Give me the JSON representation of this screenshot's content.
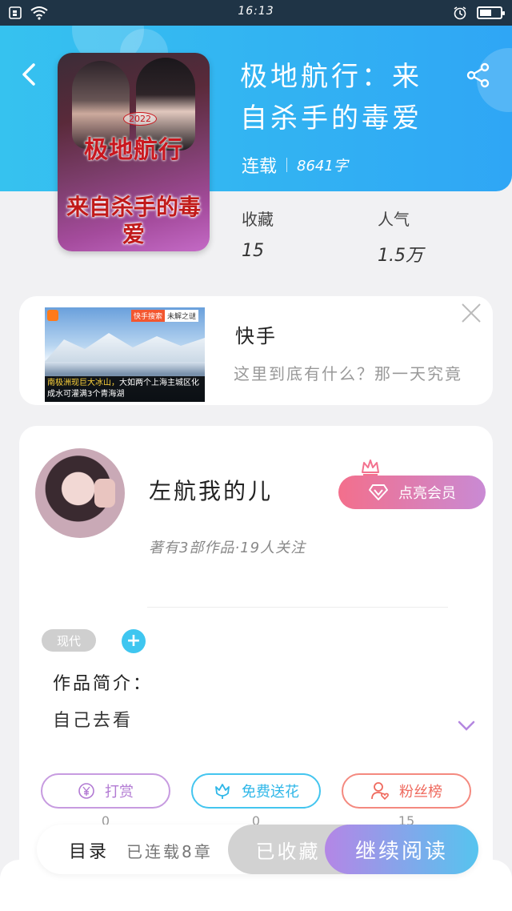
{
  "status_bar": {
    "time": "16:13"
  },
  "book": {
    "cover_title_line1": "极地航行",
    "cover_year": "2022",
    "cover_title_line2": "来自杀手的毒爱",
    "title_line1": "极地航行：来",
    "title_line2": "自杀手的毒爱",
    "status": "连载",
    "word_count": "8641字"
  },
  "stats": {
    "favorites_label": "收藏",
    "favorites_value": "15",
    "popularity_label": "人气",
    "popularity_value": "1.5万"
  },
  "ad": {
    "title": "快手",
    "description": "这里到底有什么？那一天究竟",
    "image_tag_search": "快手搜索",
    "image_tag_mystery": "未解之谜",
    "image_caption_highlight": "南极洲现巨大冰山，",
    "image_caption_rest": "大如两个上海主城区化成水可灌满3个青海湖"
  },
  "author": {
    "name": "左航我的儿",
    "meta": "著有3部作品·19人关注",
    "vip_button": "点亮会员"
  },
  "tags": {
    "genre": "现代",
    "add": "+"
  },
  "intro": {
    "heading": "作品简介：",
    "body": "自己去看"
  },
  "actions": {
    "tip_label": "打赏",
    "tip_count": "0",
    "flower_label": "免费送花",
    "flower_count": "0",
    "fans_label": "粉丝榜",
    "fans_count": "15"
  },
  "bottom_bar": {
    "toc": "目录",
    "chapters": "已连载8章",
    "favorited": "已收藏",
    "continue_reading": "继续阅读"
  },
  "colors": {
    "header_start": "#36c2ef",
    "header_end": "#2fa6f5",
    "vip_start": "#f36f8c",
    "vip_end": "#c98ad4",
    "read_start": "#b486e6",
    "read_end": "#56c4ef"
  }
}
